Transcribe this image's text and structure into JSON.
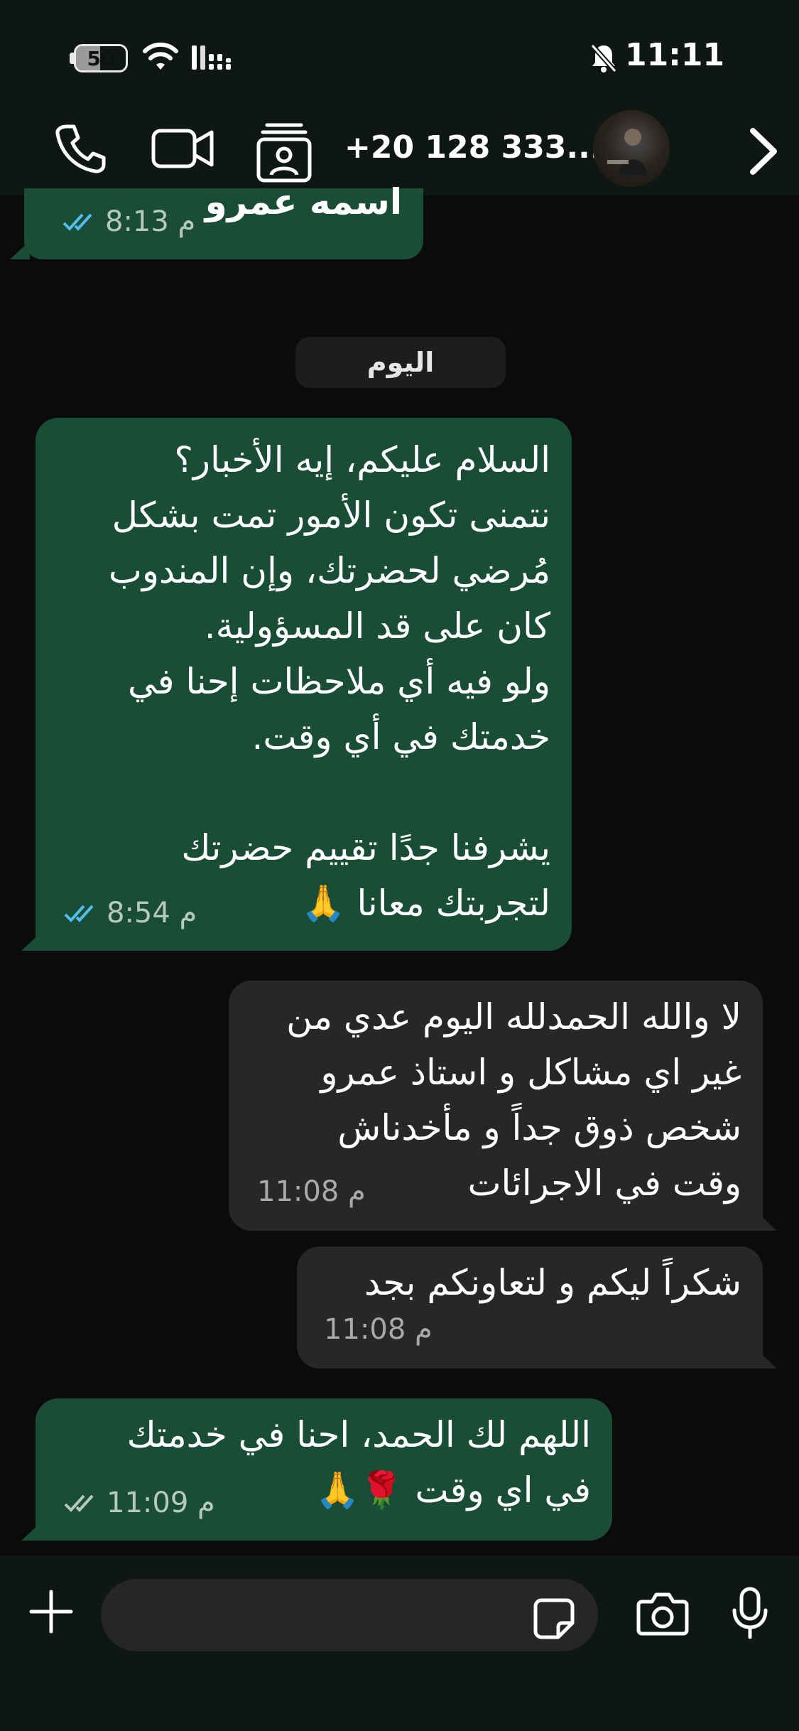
{
  "status_bar": {
    "battery_level": "50",
    "time": "11:11"
  },
  "header": {
    "contact_title": "+20 128 333..."
  },
  "chat": {
    "day_separator": "اليوم",
    "messages": [
      {
        "direction": "outgoing",
        "text": "اسمه عمرو",
        "time": "8:13 م",
        "status": "read"
      },
      {
        "direction": "outgoing",
        "text": "السلام عليكم، إيه الأخبار؟\nنتمنى تكون الأمور تمت بشكل\nمُرضي لحضرتك، وإن المندوب\nكان على قد المسؤولية.\nولو فيه أي ملاحظات إحنا في\nخدمتك في أي وقت.\n\nيشرفنا جدًا تقييم حضرتك\nلتجربتك معانا 🙏",
        "time": "8:54 م",
        "status": "read"
      },
      {
        "direction": "incoming",
        "text": "لا والله الحمدلله اليوم عدي من\nغير اي مشاكل و استاذ عمرو\nشخص ذوق جداً و مأخدناش\nوقت في الاجرائات",
        "time": "11:08 م"
      },
      {
        "direction": "incoming",
        "text": "شكراً ليكم و لتعاونكم بجد",
        "time": "11:08 م"
      },
      {
        "direction": "outgoing",
        "text": "اللهم لك الحمد، احنا في خدمتك\nفي اي وقت 🌹🙏",
        "time": "11:09 م",
        "status": "delivered"
      }
    ]
  },
  "icons": {
    "call": "phone-icon",
    "video": "video-call-icon",
    "contact_card": "contact-card-icon",
    "chevron": "chevron-right-icon",
    "plus": "plus-icon",
    "sticker": "sticker-icon",
    "camera": "camera-icon",
    "mic": "microphone-icon"
  },
  "colors": {
    "outgoing_bubble": "#1a4d37",
    "incoming_bubble": "#272727",
    "read_ticks": "#53bdeb",
    "background": "#0b0b0b"
  }
}
